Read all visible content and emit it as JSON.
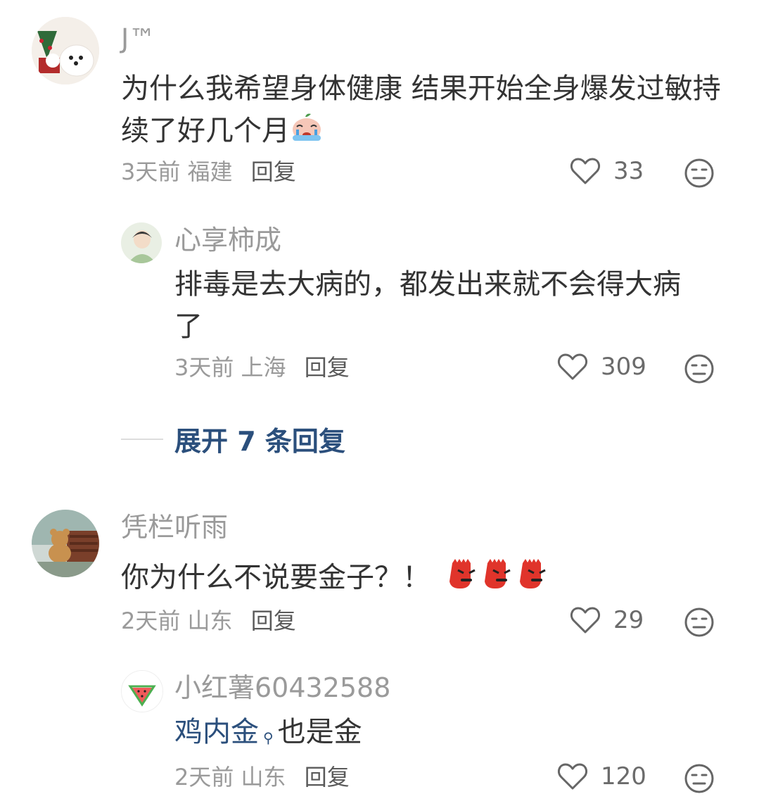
{
  "comments": [
    {
      "user": "J™",
      "text": "为什么我希望身体健康 结果开始全身爆发过敏持续了好几个月",
      "emoji": "crying-bun-emoji",
      "time": "3天前",
      "location": "福建",
      "reply_label": "回复",
      "likes": "33",
      "replies": [
        {
          "user": "心享柿成",
          "text_line1": "排毒是去大病的，都发出来就不会得大病",
          "text_line2": "了",
          "time": "3天前",
          "location": "上海",
          "reply_label": "回复",
          "likes": "309"
        }
      ],
      "expand_label": "展开 7 条回复"
    },
    {
      "user": "凭栏听雨",
      "text": "你为什么不说要金子？！",
      "emoji": "angry-face-emoji",
      "time": "2天前",
      "location": "山东",
      "reply_label": "回复",
      "likes": "29",
      "replies": [
        {
          "user": "小红薯60432588",
          "text_link": "鸡内金",
          "text_rest": "也是金",
          "time": "2天前",
          "location": "山东",
          "reply_label": "回复",
          "likes": "120"
        }
      ]
    }
  ],
  "colors": {
    "link": "#2b4f7c",
    "muted": "#9a9a9a",
    "text": "#333333"
  }
}
